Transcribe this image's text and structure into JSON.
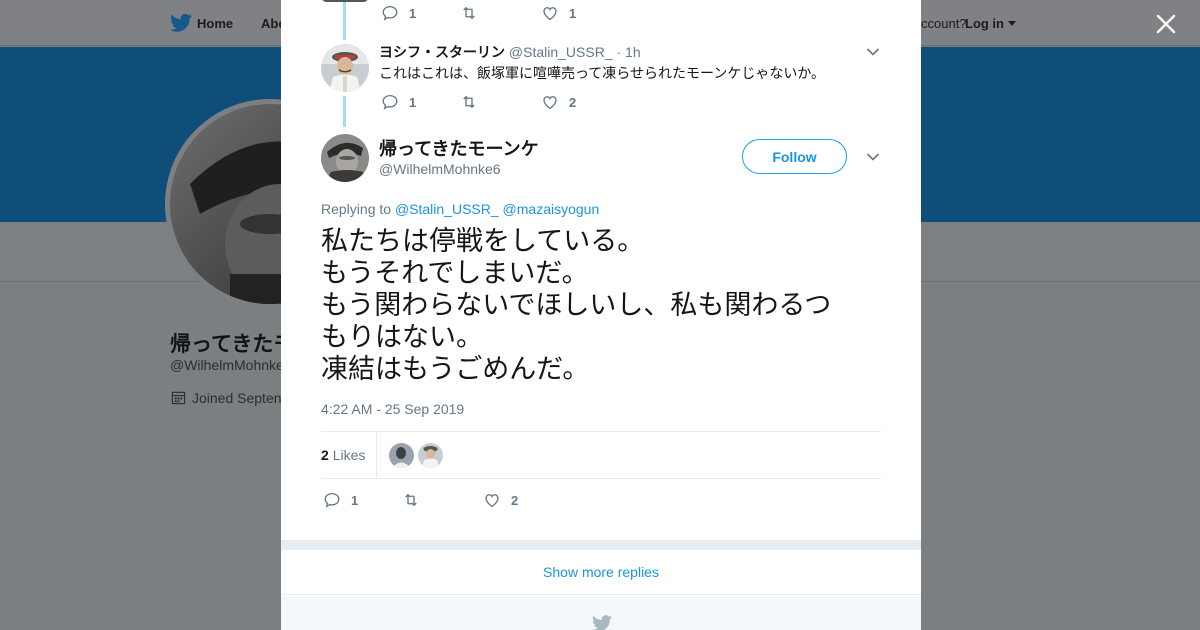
{
  "topbar": {
    "home_label": "Home",
    "about_label": "Abo",
    "account_text": "ccount?",
    "login_label": "Log in"
  },
  "profile": {
    "name": "帰ってきたモ",
    "handle": "@WilhelmMohnke",
    "joined": "Joined Septen"
  },
  "thread": {
    "parent_actions": {
      "reply_count": "1",
      "like_count": "1"
    },
    "reply": {
      "display_name": "ヨシフ・スターリン",
      "handle": "@Stalin_USSR_",
      "separator": "·",
      "time": "1h",
      "text": "これはこれは、飯塚軍に喧嘩売って凍らせられたモーンケじゃないか。",
      "reply_count": "1",
      "like_count": "2"
    },
    "main": {
      "display_name": "帰ってきたモーンケ",
      "handle": "@WilhelmMohnke6",
      "follow_label": "Follow",
      "replying_prefix": "Replying to",
      "replying_to": [
        "@Stalin_USSR_",
        "@mazaisyogun"
      ],
      "body_lines": [
        "私たちは停戦をしている。",
        "もうそれでしまいだ。",
        "もう関わらないでほしいし、私も関わるつ",
        "もりはない。",
        "凍結はもうごめんだ。"
      ],
      "timestamp": "4:22 AM - 25 Sep 2019",
      "likes_number": "2",
      "likes_label": "Likes",
      "reply_count": "1",
      "like_count": "2"
    }
  },
  "show_more_label": "Show more replies",
  "colors": {
    "accent": "#1da1f2",
    "link": "#1b95e0",
    "thread_line": "#a4d9f5",
    "banner": "#0f4e79",
    "overlay": "#7c7f82"
  },
  "icons": [
    "twitter-bird-icon",
    "close-icon",
    "reply-icon",
    "retweet-icon",
    "like-icon",
    "chevron-down-icon",
    "calendar-icon"
  ]
}
